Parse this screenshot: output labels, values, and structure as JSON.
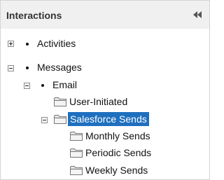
{
  "header": {
    "title": "Interactions",
    "collapse_icon": "double-chevron-left-icon"
  },
  "tree": {
    "activities": {
      "label": "Activities",
      "expanded": false
    },
    "messages": {
      "label": "Messages",
      "expanded": true
    },
    "email": {
      "label": "Email",
      "expanded": true
    },
    "user_initiated": {
      "label": "User-Initiated"
    },
    "salesforce_sends": {
      "label": "Salesforce Sends",
      "expanded": true,
      "selected": true
    },
    "monthly_sends": {
      "label": "Monthly Sends"
    },
    "periodic_sends": {
      "label": "Periodic Sends"
    },
    "weekly_sends": {
      "label": "Weekly Sends"
    }
  },
  "colors": {
    "selection": "#1f6fbf",
    "header_bg": "#f0f0f0"
  }
}
